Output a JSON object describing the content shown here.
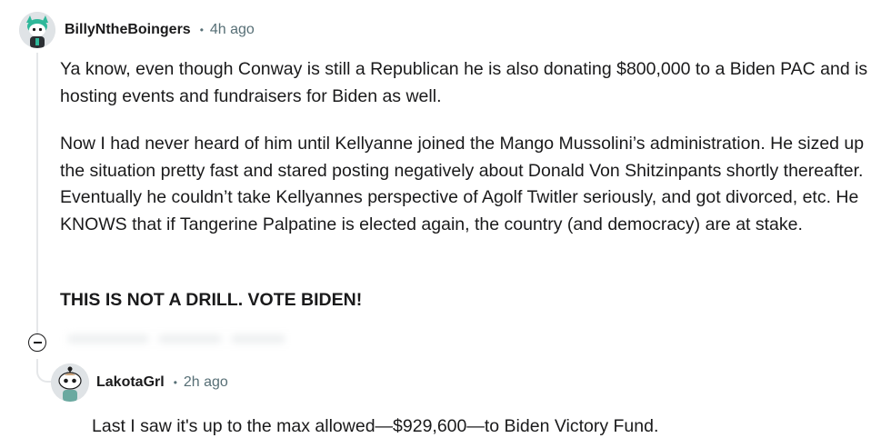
{
  "comment": {
    "username": "BillyNtheBoingers",
    "time": "4h ago",
    "avatar_icon": "snoo-avatar-icon",
    "paragraphs": [
      "Ya know, even though Conway is still a Republican he is also donating $800,000 to a Biden PAC and is hosting events and fundraisers for Biden as well.",
      "Now I had never heard of him until Kellyanne joined the Mango Mussolini’s administration. He sized up the situation pretty fast and stared posting negatively about Donald Von Shitzinpants shortly thereafter. Eventually he couldn’t take Kellyannes perspective of Agolf Twitler seriously, and got divorced, etc. He KNOWS that if Tangerine Palpatine is elected again, the country (and democracy) are at stake.",
      "THIS IS NOT A DRILL. VOTE BIDEN!"
    ]
  },
  "reply": {
    "username": "LakotaGrl",
    "time": "2h ago",
    "avatar_icon": "snoo-avatar-icon",
    "text": "Last I saw it's up to the max allowed—$929,600—to Biden Victory Fund."
  },
  "controls": {
    "collapse_icon": "collapse-thread-icon"
  },
  "colors": {
    "text": "#1a1a1b",
    "meta": "#576f76",
    "rail": "#e5e7e9",
    "avatar1_accent": "#2fb89a",
    "avatar2_accent": "#c9a27a"
  }
}
